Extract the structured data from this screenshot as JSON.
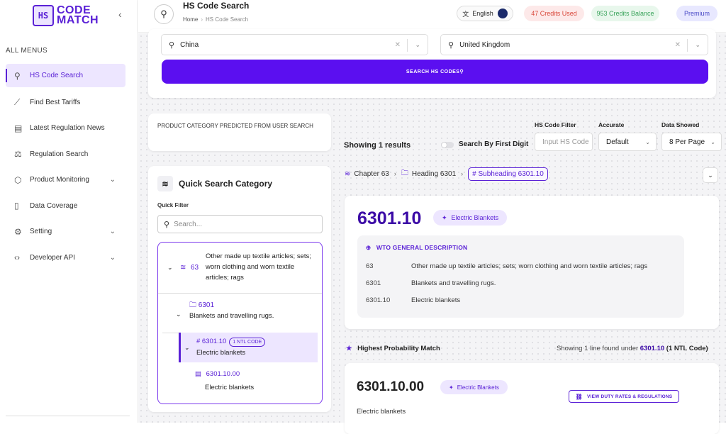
{
  "logo": {
    "icon_text": "HS",
    "line1": "CODE",
    "line2": "MATCH"
  },
  "sidebar": {
    "menu_header": "ALL MENUS",
    "items": [
      {
        "label": "HS Code Search",
        "icon": "search-icon"
      },
      {
        "label": "Find Best Tariffs",
        "icon": "trend-icon"
      },
      {
        "label": "Latest Regulation News",
        "icon": "news-icon"
      },
      {
        "label": "Regulation Search",
        "icon": "scale-icon"
      },
      {
        "label": "Product Monitoring",
        "icon": "box-icon"
      },
      {
        "label": "Data Coverage",
        "icon": "document-icon"
      },
      {
        "label": "Setting",
        "icon": "gear-icon"
      },
      {
        "label": "Developer API",
        "icon": "code-icon"
      }
    ]
  },
  "header": {
    "title": "HS Code Search",
    "breadcrumb_home": "Home",
    "breadcrumb_current": "HS Code Search",
    "language": "English",
    "credits_used": "47 Credits Used",
    "credits_balance": "953 Credits Balance",
    "plan": "Premium"
  },
  "search": {
    "from_country": "China",
    "to_country": "United Kingdom",
    "button_label": "SEARCH HS CODES"
  },
  "predicted": {
    "label": "PRODUCT CATEGORY PREDICTED FROM USER SEARCH"
  },
  "quick_search": {
    "title": "Quick Search Category",
    "filter_label": "Quick Filter",
    "filter_placeholder": "Search...",
    "tree": {
      "chapter_code": "63",
      "chapter_desc": "Other made up textile articles; sets; worn clothing and worn textile articles; rags",
      "heading_code": "6301",
      "heading_desc": "Blankets and travelling rugs.",
      "subheading_code": "# 6301.10",
      "subheading_badge": "1 NTL CODE",
      "subheading_desc": "Electric blankets",
      "ntl_code": "6301.10.00",
      "ntl_desc": "Electric blankets"
    }
  },
  "results": {
    "showing": "Showing 1 results",
    "first_digit_label": "Search By First Digit",
    "hs_filter_label": "HS Code Filter",
    "hs_filter_placeholder": "Input HS Code",
    "accurate_label": "Accurate",
    "accurate_value": "Default",
    "data_showed_label": "Data Showed",
    "data_showed_value": "8 Per Page"
  },
  "breadcrumbs": {
    "chapter": "Chapter 63",
    "heading": "Heading 6301",
    "subheading": "# Subheading 6301.10"
  },
  "detail": {
    "code": "6301.10",
    "tag": "Electric Blankets",
    "wto_header": "WTO GENERAL DESCRIPTION",
    "rows": [
      {
        "code": "63",
        "desc": "Other made up textile articles; sets; worn clothing and worn textile articles; rags"
      },
      {
        "code": "6301",
        "desc": "Blankets and travelling rugs."
      },
      {
        "code": "6301.10",
        "desc": "Electric blankets"
      }
    ]
  },
  "highest": {
    "title": "Highest Probability Match",
    "info_prefix": "Showing 1 line found under",
    "info_code": "6301.10",
    "info_suffix": "(1 NTL Code)"
  },
  "match": {
    "code": "6301.10.00",
    "tag": "Electric Blankets",
    "duty_button": "VIEW DUTY RATES & REGULATIONS",
    "desc": "Electric blankets"
  }
}
